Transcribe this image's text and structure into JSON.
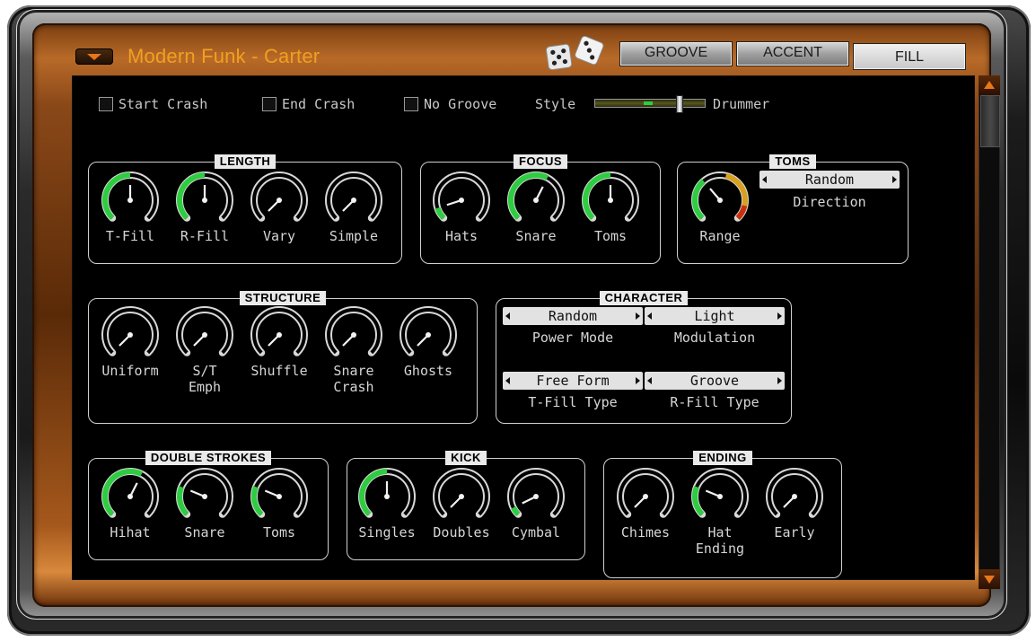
{
  "header": {
    "title": "Modern Funk - Carter",
    "tabs": [
      {
        "label": "GROOVE",
        "active": false
      },
      {
        "label": "ACCENT",
        "active": false
      },
      {
        "label": "FILL",
        "active": true
      }
    ],
    "menu_icon": "menu-triangle-icon",
    "dice_icon": "dice-icon"
  },
  "options": {
    "start_crash": {
      "label": "Start Crash",
      "checked": false
    },
    "end_crash": {
      "label": "End Crash",
      "checked": false
    },
    "no_groove": {
      "label": "No Groove",
      "checked": false
    },
    "style_label": "Style",
    "drummer_label": "Drummer",
    "style_slider_value": 0.78
  },
  "groups": {
    "length": {
      "title": "LENGTH",
      "knobs": [
        {
          "label": "T-Fill",
          "value": 0.5
        },
        {
          "label": "R-Fill",
          "value": 0.5
        },
        {
          "label": "Vary",
          "value": 0.0
        },
        {
          "label": "Simple",
          "value": 0.0
        }
      ]
    },
    "focus": {
      "title": "FOCUS",
      "knobs": [
        {
          "label": "Hats",
          "value": 0.1
        },
        {
          "label": "Snare",
          "value": 0.6
        },
        {
          "label": "Toms",
          "value": 0.5
        }
      ]
    },
    "toms": {
      "title": "TOMS",
      "knobs": [
        {
          "label": "Range",
          "value": 0.35,
          "meter": true
        }
      ],
      "selectors": [
        {
          "value": "Random",
          "label": "Direction"
        }
      ]
    },
    "structure": {
      "title": "STRUCTURE",
      "knobs": [
        {
          "label": "Uniform",
          "value": 0.0
        },
        {
          "label": "S/T\nEmph",
          "value": 0.0
        },
        {
          "label": "Shuffle",
          "value": 0.0
        },
        {
          "label": "Snare\nCrash",
          "value": 0.0
        },
        {
          "label": "Ghosts",
          "value": 0.0
        }
      ]
    },
    "character": {
      "title": "CHARACTER",
      "selectors": [
        {
          "value": "Random",
          "label": "Power Mode"
        },
        {
          "value": "Light",
          "label": "Modulation"
        },
        {
          "value": "Free Form",
          "label": "T-Fill Type"
        },
        {
          "value": "Groove",
          "label": "R-Fill Type"
        }
      ]
    },
    "double_strokes": {
      "title": "DOUBLE STROKES",
      "knobs": [
        {
          "label": "Hihat",
          "value": 0.6
        },
        {
          "label": "Snare",
          "value": 0.25
        },
        {
          "label": "Toms",
          "value": 0.25
        }
      ]
    },
    "kick": {
      "title": "KICK",
      "knobs": [
        {
          "label": "Singles",
          "value": 0.5
        },
        {
          "label": "Doubles",
          "value": 0.0
        },
        {
          "label": "Cymbal",
          "value": 0.07
        }
      ]
    },
    "ending": {
      "title": "ENDING",
      "knobs": [
        {
          "label": "Chimes",
          "value": 0.0
        },
        {
          "label": "Hat\nEnding",
          "value": 0.25
        },
        {
          "label": "Early",
          "value": 0.0
        }
      ]
    }
  },
  "colors": {
    "accent_orange": "#f0a020",
    "knob_fill_green": "#2ecc40",
    "panel_bg": "#000000",
    "copper": "#a5581c"
  }
}
